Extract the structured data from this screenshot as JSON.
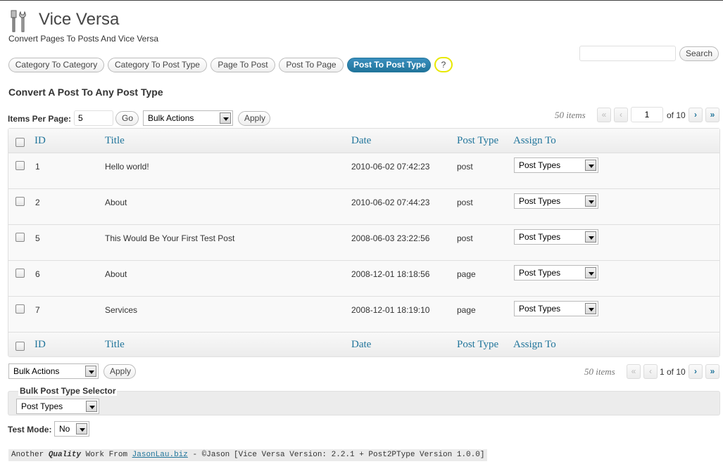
{
  "header": {
    "title": "Vice Versa",
    "subtitle": "Convert Pages To Posts And Vice Versa",
    "logo_icon": "tools-icon"
  },
  "search": {
    "button_label": "Search",
    "value": ""
  },
  "tabs": [
    {
      "label": "Category To Category",
      "active": false
    },
    {
      "label": "Category To Post Type",
      "active": false
    },
    {
      "label": "Page To Post",
      "active": false
    },
    {
      "label": "Post To Page",
      "active": false
    },
    {
      "label": "Post To Post Type",
      "active": true
    },
    {
      "label": "?",
      "active": false
    }
  ],
  "section_title": "Convert A Post To Any Post Type",
  "controls": {
    "items_per_page_label": "Items Per Page:",
    "items_per_page_value": "5",
    "go_label": "Go",
    "bulk_actions": "Bulk Actions",
    "apply_label": "Apply"
  },
  "pagination": {
    "items_text": "50 items",
    "first": "«",
    "prev": "‹",
    "next": "›",
    "last": "»",
    "current_page": "1",
    "of_text": "of 10",
    "bottom_text": "1 of 10"
  },
  "table": {
    "columns": [
      "ID",
      "Title",
      "Date",
      "Post Type",
      "Assign To"
    ],
    "select_default": "Post Types",
    "rows": [
      {
        "id": "1",
        "title": "Hello world!",
        "date": "2010-06-02 07:42:23",
        "post_type": "post",
        "assign": "Post Types"
      },
      {
        "id": "2",
        "title": "About",
        "date": "2010-06-02 07:44:23",
        "post_type": "post",
        "assign": "Post Types"
      },
      {
        "id": "5",
        "title": "This Would Be Your First Test Post",
        "date": "2008-06-03 23:22:56",
        "post_type": "post",
        "assign": "Post Types"
      },
      {
        "id": "6",
        "title": "About",
        "date": "2008-12-01 18:18:56",
        "post_type": "page",
        "assign": "Post Types"
      },
      {
        "id": "7",
        "title": "Services",
        "date": "2008-12-01 18:19:10",
        "post_type": "page",
        "assign": "Post Types"
      }
    ]
  },
  "bulk_selector": {
    "legend": "Bulk Post Type Selector",
    "value": "Post Types"
  },
  "test_mode": {
    "label": "Test Mode:",
    "value": "No"
  },
  "footer": {
    "prefix": "Another ",
    "quality": "Quality",
    "mid": " Work From ",
    "link": "JasonLau.biz",
    "suffix": " - ©Jason Lau",
    "version": "[Vice Versa Version: 2.2.1 + Post2PType Version 1.0.0]"
  },
  "colors": {
    "accent": "#21759b",
    "help_border": "#e8e800"
  }
}
